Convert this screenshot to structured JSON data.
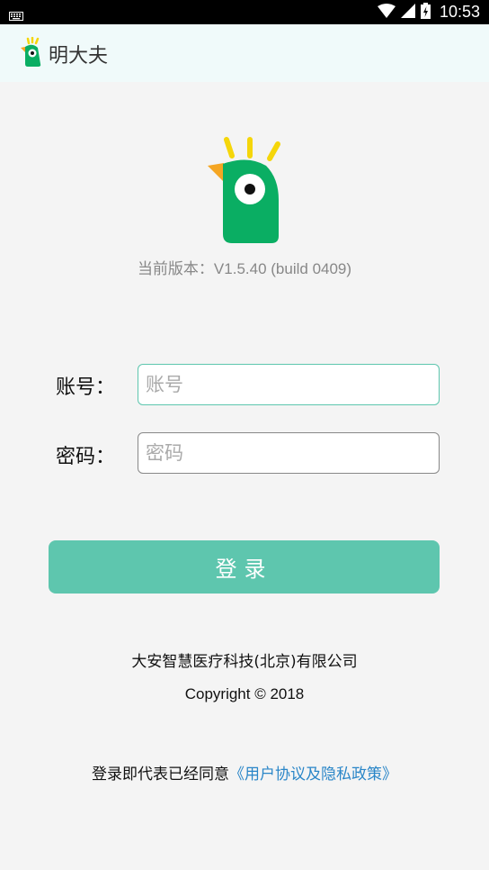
{
  "status_bar": {
    "time": "10:53"
  },
  "app_bar": {
    "title": "明大夫"
  },
  "version": {
    "text": "当前版本：V1.5.40 (build 0409)"
  },
  "form": {
    "account_label": "账号：",
    "account_placeholder": "账号",
    "password_label": "密码：",
    "password_placeholder": "密码"
  },
  "login_button": {
    "label": "登录"
  },
  "footer": {
    "company": "大安智慧医疗科技(北京)有限公司",
    "copyright": "Copyright © 2018",
    "agreement_prefix": "登录即代表已经同意",
    "agreement_link": "《用户协议及隐私政策》"
  },
  "colors": {
    "brand_green": "#0aae63",
    "accent": "#5ec6ae",
    "link": "#2a86c8",
    "beak": "#f5a623",
    "crest": "#f5d60a"
  },
  "icons": [
    "keyboard-icon",
    "wifi-icon",
    "signal-icon",
    "battery-icon",
    "app-logo-icon"
  ]
}
